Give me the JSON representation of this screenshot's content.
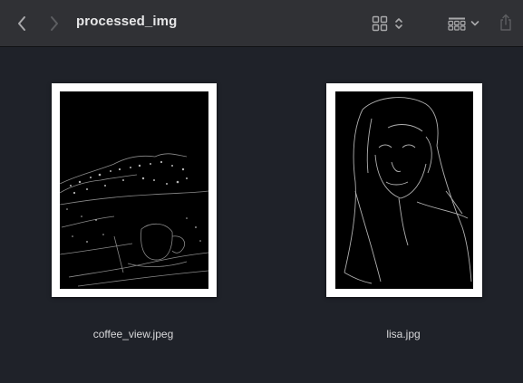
{
  "window": {
    "title": "processed_img"
  },
  "toolbar": {
    "back_icon": "chevron-left-icon",
    "forward_icon": "chevron-right-icon",
    "view_icon": "icon-grid-view-icon",
    "group_icon": "group-by-icon",
    "share_icon": "share-icon"
  },
  "files": [
    {
      "name": "coffee_view.jpeg",
      "thumbnail": "edge-detected landscape with coffee cup"
    },
    {
      "name": "lisa.jpg",
      "thumbnail": "edge-detected portrait"
    }
  ],
  "colors": {
    "toolbar_bg": "#303135",
    "content_bg": "#1f2229",
    "text": "#e6e6e7",
    "icon": "#a9a9ab"
  }
}
